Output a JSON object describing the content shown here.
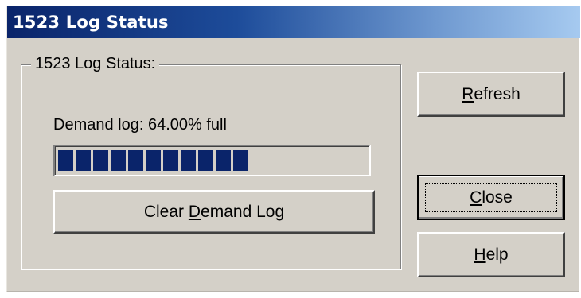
{
  "window": {
    "title": "1523 Log Status"
  },
  "group": {
    "label": "1523 Log Status:"
  },
  "demand_log": {
    "label": "Demand log: 64.00% full",
    "percent_full": 64.0
  },
  "buttons": {
    "clear_pre": "Clear ",
    "clear_mnemonic": "D",
    "clear_post": "emand Log",
    "refresh_mnemonic": "R",
    "refresh_post": "efresh",
    "close_mnemonic": "C",
    "close_post": "lose",
    "help_mnemonic": "H",
    "help_post": "elp"
  },
  "colors": {
    "title_bar_start": "#0a246a",
    "title_bar_end": "#a6caf0",
    "dialog_face": "#d4d0c8",
    "progress_block": "#0a246a"
  }
}
